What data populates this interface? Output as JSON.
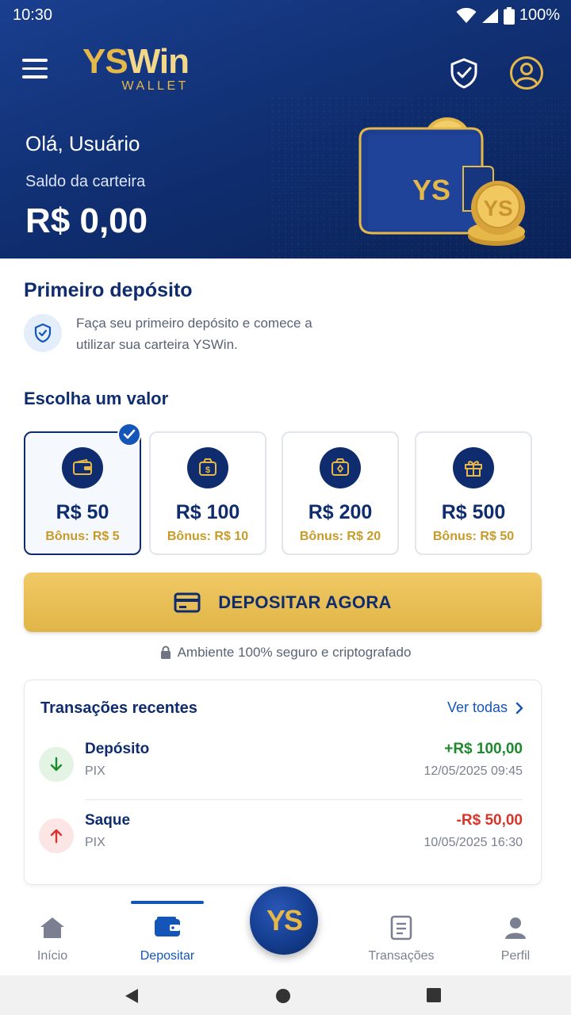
{
  "status_bar": {
    "time": "10:30",
    "battery": "100%"
  },
  "header": {
    "brand_ys": "YS",
    "brand_win": "Win",
    "brand_sub": "WALLET",
    "greeting": "Olá, Usuário",
    "balance_label": "Saldo da carteira",
    "balance_value": "R$ 0,00",
    "wallet_badge": "YS",
    "coin_badge": "YS"
  },
  "first_deposit": {
    "title": "Primeiro depósito",
    "description": "Faça seu primeiro depósito e comece a utilizar sua carteira YSWin."
  },
  "amounts": {
    "title": "Escolha um valor",
    "options": [
      {
        "value": "R$ 50",
        "bonus": "Bônus: R$ 5",
        "icon": "wallet-icon",
        "selected": true
      },
      {
        "value": "R$ 100",
        "bonus": "Bônus: R$ 10",
        "icon": "money-bag-icon",
        "selected": false
      },
      {
        "value": "R$ 200",
        "bonus": "Bônus: R$ 20",
        "icon": "money-bag-icon",
        "selected": false
      },
      {
        "value": "R$ 500",
        "bonus": "Bônus: R$ 50",
        "icon": "gift-icon",
        "selected": false
      }
    ]
  },
  "deposit_button": {
    "label": "DEPOSITAR AGORA"
  },
  "secure_note": "Ambiente 100% seguro e criptografado",
  "transactions": {
    "title": "Transações recentes",
    "see_all": "Ver todas",
    "items": [
      {
        "name": "Depósito",
        "method": "PIX",
        "amount": "+R$ 100,00",
        "date": "12/05/2025 09:45",
        "color": "#1e8a2e"
      },
      {
        "name": "Saque",
        "method": "PIX",
        "amount": "-R$ 50,00",
        "date": "10/05/2025 16:30",
        "color": "#d9342b"
      }
    ]
  },
  "bottom_nav": {
    "items": [
      {
        "label": "Início",
        "active": false
      },
      {
        "label": "Depositar",
        "active": true
      },
      {
        "label": "Transações",
        "active": false
      },
      {
        "label": "Perfil",
        "active": false
      }
    ],
    "center_badge": "YS"
  },
  "colors": {
    "navy": "#0f2d6e",
    "gold": "#e6b84a",
    "accent_blue": "#1456b8"
  }
}
